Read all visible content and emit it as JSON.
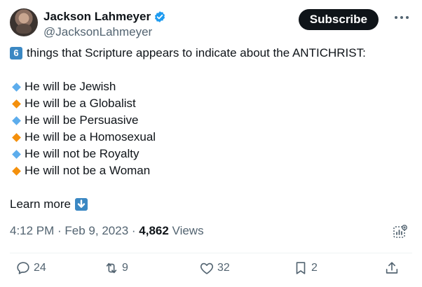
{
  "author": {
    "display_name": "Jackson Lahmeyer",
    "handle": "@JacksonLahmeyer",
    "verified": true
  },
  "subscribe_label": "Subscribe",
  "tweet": {
    "intro_number": "6",
    "intro_text": "things that Scripture appears to indicate about the ANTICHRIST:",
    "items": [
      {
        "marker": "blue-diamond",
        "text": "He will be Jewish"
      },
      {
        "marker": "orange-diamond",
        "text": "He will be a Globalist"
      },
      {
        "marker": "blue-diamond",
        "text": "He will be Persuasive"
      },
      {
        "marker": "orange-diamond",
        "text": "He will be a Homosexual"
      },
      {
        "marker": "blue-diamond",
        "text": "He will not be Royalty"
      },
      {
        "marker": "orange-diamond",
        "text": "He will not be a Woman"
      }
    ],
    "learn_more": "Learn more"
  },
  "meta": {
    "timestamp": "4:12 PM · Feb 9, 2023 · ",
    "views_count": "4,862",
    "views_label": " Views"
  },
  "actions": {
    "replies": "24",
    "reposts": "9",
    "likes": "32",
    "bookmarks": "2"
  },
  "colors": {
    "accent": "#1d9bf0",
    "blue_diamond": "#5dadec",
    "orange_diamond": "#f4900c",
    "keycap": "#3b88c3"
  }
}
